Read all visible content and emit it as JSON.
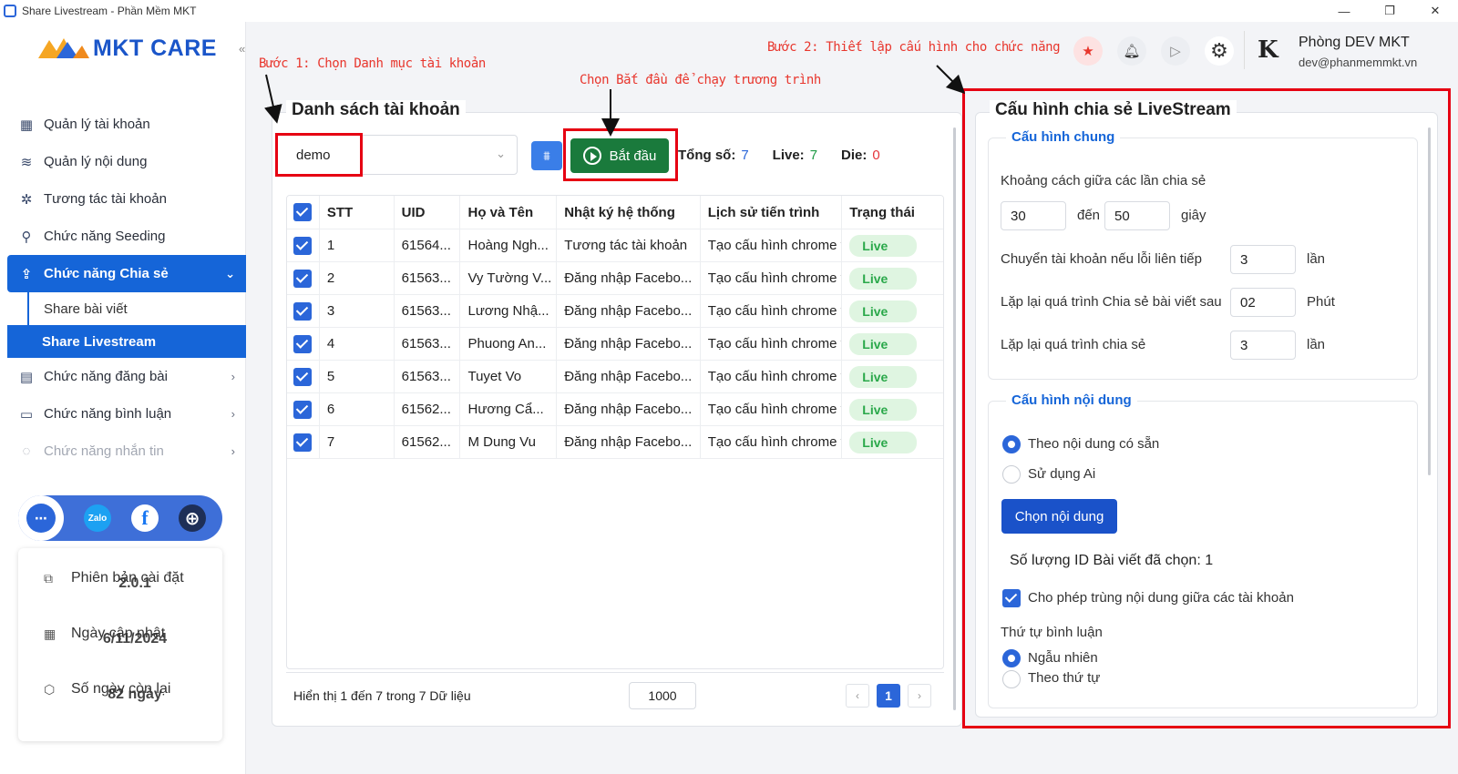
{
  "window": {
    "title": "Share Livestream - Phần Mềm MKT",
    "minimize": "—",
    "maximize": "❐",
    "close": "✕"
  },
  "brand": {
    "logo_text": "MKT CARE"
  },
  "sidebar": {
    "items": [
      {
        "label": "Quản lý tài khoản",
        "icon": "▦"
      },
      {
        "label": "Quản lý nội dung",
        "icon": "≋"
      },
      {
        "label": "Tương tác tài khoản",
        "icon": "✲"
      },
      {
        "label": "Chức năng Seeding",
        "icon": "⚲"
      },
      {
        "label": "Chức năng Chia sẻ",
        "icon": "⇪"
      }
    ],
    "subitems": [
      {
        "label": "Share bài viết"
      },
      {
        "label": "Share Livestream"
      }
    ],
    "items_after": [
      {
        "label": "Chức năng đăng bài",
        "icon": "▤"
      },
      {
        "label": "Chức năng bình luận",
        "icon": "▭"
      },
      {
        "label": "Chức năng nhắn tin",
        "icon": "◌"
      }
    ],
    "social": {
      "zalo": "Zalo",
      "facebook": "f",
      "web": "⊕",
      "support": "⋯"
    },
    "info": {
      "version_label": "Phiên bản cài đặt",
      "version": "2.0.1",
      "update_label": "Ngày cập nhật",
      "update": "6/11/2024",
      "remain_label": "Số ngày còn lại",
      "remain": "82 ngày"
    }
  },
  "header": {
    "user_name": "Phòng DEV MKT",
    "user_email": "dev@phanmemmkt.vn",
    "user_logo": "K"
  },
  "annotations": {
    "step1": "Bước 1: Chọn Danh mục tài khoản",
    "start": "Chọn Bắt đầu để chạy trương trình",
    "step2": "Bước 2: Thiết lập cấu hình cho chức năng"
  },
  "accounts": {
    "title": "Danh sách tài khoản",
    "category": "demo",
    "start_label": "Bắt đầu",
    "total_label": "Tổng số:",
    "total": "7",
    "live_label": "Live:",
    "live": "7",
    "die_label": "Die:",
    "die": "0",
    "columns": [
      "STT",
      "UID",
      "Họ và Tên",
      "Nhật ký hệ thống",
      "Lịch sử tiến trình",
      "Trạng thái"
    ],
    "rows": [
      {
        "stt": "1",
        "uid": "61564...",
        "name": "Hoàng Ngh...",
        "log": "Tương tác tài khoản",
        "history": "Tạo cấu hình chrome t",
        "status": "Live"
      },
      {
        "stt": "2",
        "uid": "61563...",
        "name": "Vy Tường V...",
        "log": "Đăng nhập Facebo...",
        "history": "Tạo cấu hình chrome t",
        "status": "Live"
      },
      {
        "stt": "3",
        "uid": "61563...",
        "name": "Lương Nhậ...",
        "log": "Đăng nhập Facebo...",
        "history": "Tạo cấu hình chrome t",
        "status": "Live"
      },
      {
        "stt": "4",
        "uid": "61563...",
        "name": "Phuong An...",
        "log": "Đăng nhập Facebo...",
        "history": "Tạo cấu hình chrome t",
        "status": "Live"
      },
      {
        "stt": "5",
        "uid": "61563...",
        "name": "Tuyet Vo",
        "log": "Đăng nhập Facebo...",
        "history": "Tạo cấu hình chrome t",
        "status": "Live"
      },
      {
        "stt": "6",
        "uid": "61562...",
        "name": "Hương Cẩ...",
        "log": "Đăng nhập Facebo...",
        "history": "Tạo cấu hình chrome t",
        "status": "Live"
      },
      {
        "stt": "7",
        "uid": "61562...",
        "name": "M Dung Vu",
        "log": "Đăng nhập Facebo...",
        "history": "Tạo cấu hình chrome t",
        "status": "Live"
      }
    ],
    "footer": "Hiển thị 1 đến 7 trong 7 Dữ liệu",
    "page_size": "1000",
    "page": "1",
    "prev": "‹",
    "next": "›"
  },
  "config": {
    "title": "Cấu hình chia sẻ LiveStream",
    "general": {
      "title": "Cấu hình chung",
      "interval_label": "Khoảng cách giữa các lần chia sẻ",
      "interval_from": "30",
      "to_label": "đến",
      "interval_to": "50",
      "unit_sec": "giây",
      "switch_label": "Chuyển tài khoản nếu lỗi liên tiếp",
      "switch_value": "3",
      "unit_times": "lần",
      "repeat_label": "Lặp lại quá trình Chia sẻ bài viết sau",
      "repeat_value": "02",
      "unit_min": "Phút",
      "loop_label": "Lặp lại quá trình chia sẻ",
      "loop_value": "3",
      "unit_times2": "lần"
    },
    "content": {
      "title": "Cấu hình nội dung",
      "opt_existing": "Theo nội dung có sẵn",
      "opt_ai": "Sử dụng Ai",
      "choose_btn": "Chọn nội dung",
      "selected_count": "Số lượng ID Bài viết đã chọn: 1",
      "allow_dup": "Cho phép trùng nội dung giữa các tài khoản",
      "order_label": "Thứ tự bình luận",
      "order_random": "Ngẫu nhiên",
      "order_seq": "Theo thứ tự"
    }
  }
}
